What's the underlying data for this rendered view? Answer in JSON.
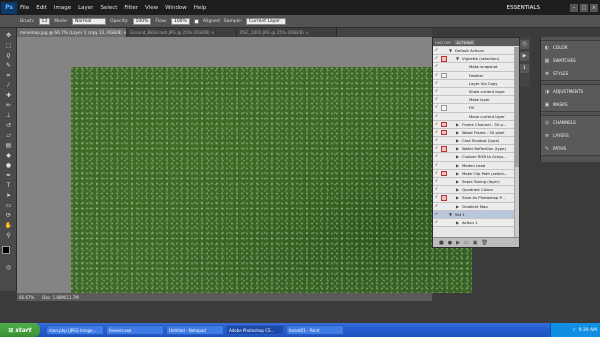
{
  "menubar": {
    "logo": "Ps",
    "items": [
      "File",
      "Edit",
      "Image",
      "Layer",
      "Select",
      "Filter",
      "View",
      "Window",
      "Help"
    ],
    "workspace": "ESSENTIALS"
  },
  "options": {
    "brush_label": "Brush:",
    "brush_size": "13",
    "mode_label": "Mode:",
    "mode_value": "Normal",
    "opacity_label": "Opacity:",
    "opacity_value": "100%",
    "flow_label": "Flow:",
    "flow_value": "100%",
    "aligned_label": "Aligned",
    "sample_label": "Sample:",
    "sample_value": "Current Layer"
  },
  "doc_tabs": [
    "minemap.jpg @ 66.7% (Layer 1 copy 12, RGB/8) ×",
    "Ground_BkGcrash.JPG @ 25% (RGB/8) ×",
    "DSC_1003.JPG @ 25% (RGB/8) ×"
  ],
  "status": {
    "zoom": "66.67%",
    "doc": "Doc: 1.88M/11.7M"
  },
  "actions_panel": {
    "tabs": [
      "HISTORY",
      "ACTIONS"
    ],
    "active_tab": "ACTIONS",
    "rows": [
      {
        "name": "Default Actions",
        "indent": 0,
        "check": "✓",
        "dialog": "none",
        "twisty": "▼",
        "folder": true
      },
      {
        "name": "Vignette (selection)",
        "indent": 1,
        "check": "✓",
        "dialog": "red",
        "twisty": "▼"
      },
      {
        "name": "Make snapshot",
        "indent": 2,
        "check": "✓",
        "dialog": "none",
        "twisty": ""
      },
      {
        "name": "Feather",
        "indent": 2,
        "check": "✓",
        "dialog": "plain",
        "twisty": ""
      },
      {
        "name": "Layer Via Copy",
        "indent": 2,
        "check": "✓",
        "dialog": "none",
        "twisty": ""
      },
      {
        "name": "Show current layer",
        "indent": 2,
        "check": "✓",
        "dialog": "none",
        "twisty": ""
      },
      {
        "name": "Make layer",
        "indent": 2,
        "check": "✓",
        "dialog": "none",
        "twisty": ""
      },
      {
        "name": "Fill",
        "indent": 2,
        "check": "✓",
        "dialog": "plain",
        "twisty": ""
      },
      {
        "name": "Move current layer",
        "indent": 2,
        "check": "✓",
        "dialog": "none",
        "twisty": ""
      },
      {
        "name": "Frame Channel - 50 p...",
        "indent": 1,
        "check": "✓",
        "dialog": "red",
        "twisty": "▶"
      },
      {
        "name": "Wood Frame - 50 pixel",
        "indent": 1,
        "check": "✓",
        "dialog": "red",
        "twisty": "▶"
      },
      {
        "name": "Cast Shadow (type)",
        "indent": 1,
        "check": "✓",
        "dialog": "none",
        "twisty": "▶"
      },
      {
        "name": "Water Reflection (type)",
        "indent": 1,
        "check": "✓",
        "dialog": "red",
        "twisty": "▶"
      },
      {
        "name": "Custom RGB to Grays...",
        "indent": 1,
        "check": "✓",
        "dialog": "none",
        "twisty": "▶"
      },
      {
        "name": "Molten Lead",
        "indent": 1,
        "check": "✓",
        "dialog": "none",
        "twisty": "▶"
      },
      {
        "name": "Make Clip Path (select...",
        "indent": 1,
        "check": "✓",
        "dialog": "red",
        "twisty": "▶"
      },
      {
        "name": "Sepia Toning (layer)",
        "indent": 1,
        "check": "✓",
        "dialog": "none",
        "twisty": "▶"
      },
      {
        "name": "Quadrant Colors",
        "indent": 1,
        "check": "✓",
        "dialog": "none",
        "twisty": "▶"
      },
      {
        "name": "Save As Photoshop P...",
        "indent": 1,
        "check": "✓",
        "dialog": "red",
        "twisty": "▶"
      },
      {
        "name": "Gradient Map",
        "indent": 1,
        "check": "✓",
        "dialog": "none",
        "twisty": "▶"
      },
      {
        "name": "Set 1",
        "indent": 0,
        "check": "✓",
        "dialog": "none",
        "twisty": "▼",
        "folder": true,
        "selected": true
      },
      {
        "name": "Action 1",
        "indent": 1,
        "check": "✓",
        "dialog": "none",
        "twisty": "▶"
      }
    ],
    "footer_icons": [
      "■",
      "●",
      "▶",
      "▭",
      "▣",
      "🗑"
    ]
  },
  "right_dock": {
    "groups": [
      [
        "COLOR",
        "SWATCHES",
        "STYLES"
      ],
      [
        "ADJUSTMENTS",
        "MASKS"
      ],
      [
        "CHANNELS",
        "LAYERS",
        "PATHS"
      ]
    ]
  },
  "taskbar": {
    "start": "start",
    "tasks": [
      "man.php (JPEG Image...",
      "forever.exe",
      "Untitled - Notepad",
      "Adobe Photoshop CS...",
      "forest01 - Paint"
    ],
    "active_index": 3,
    "time": "9:30 AM"
  }
}
